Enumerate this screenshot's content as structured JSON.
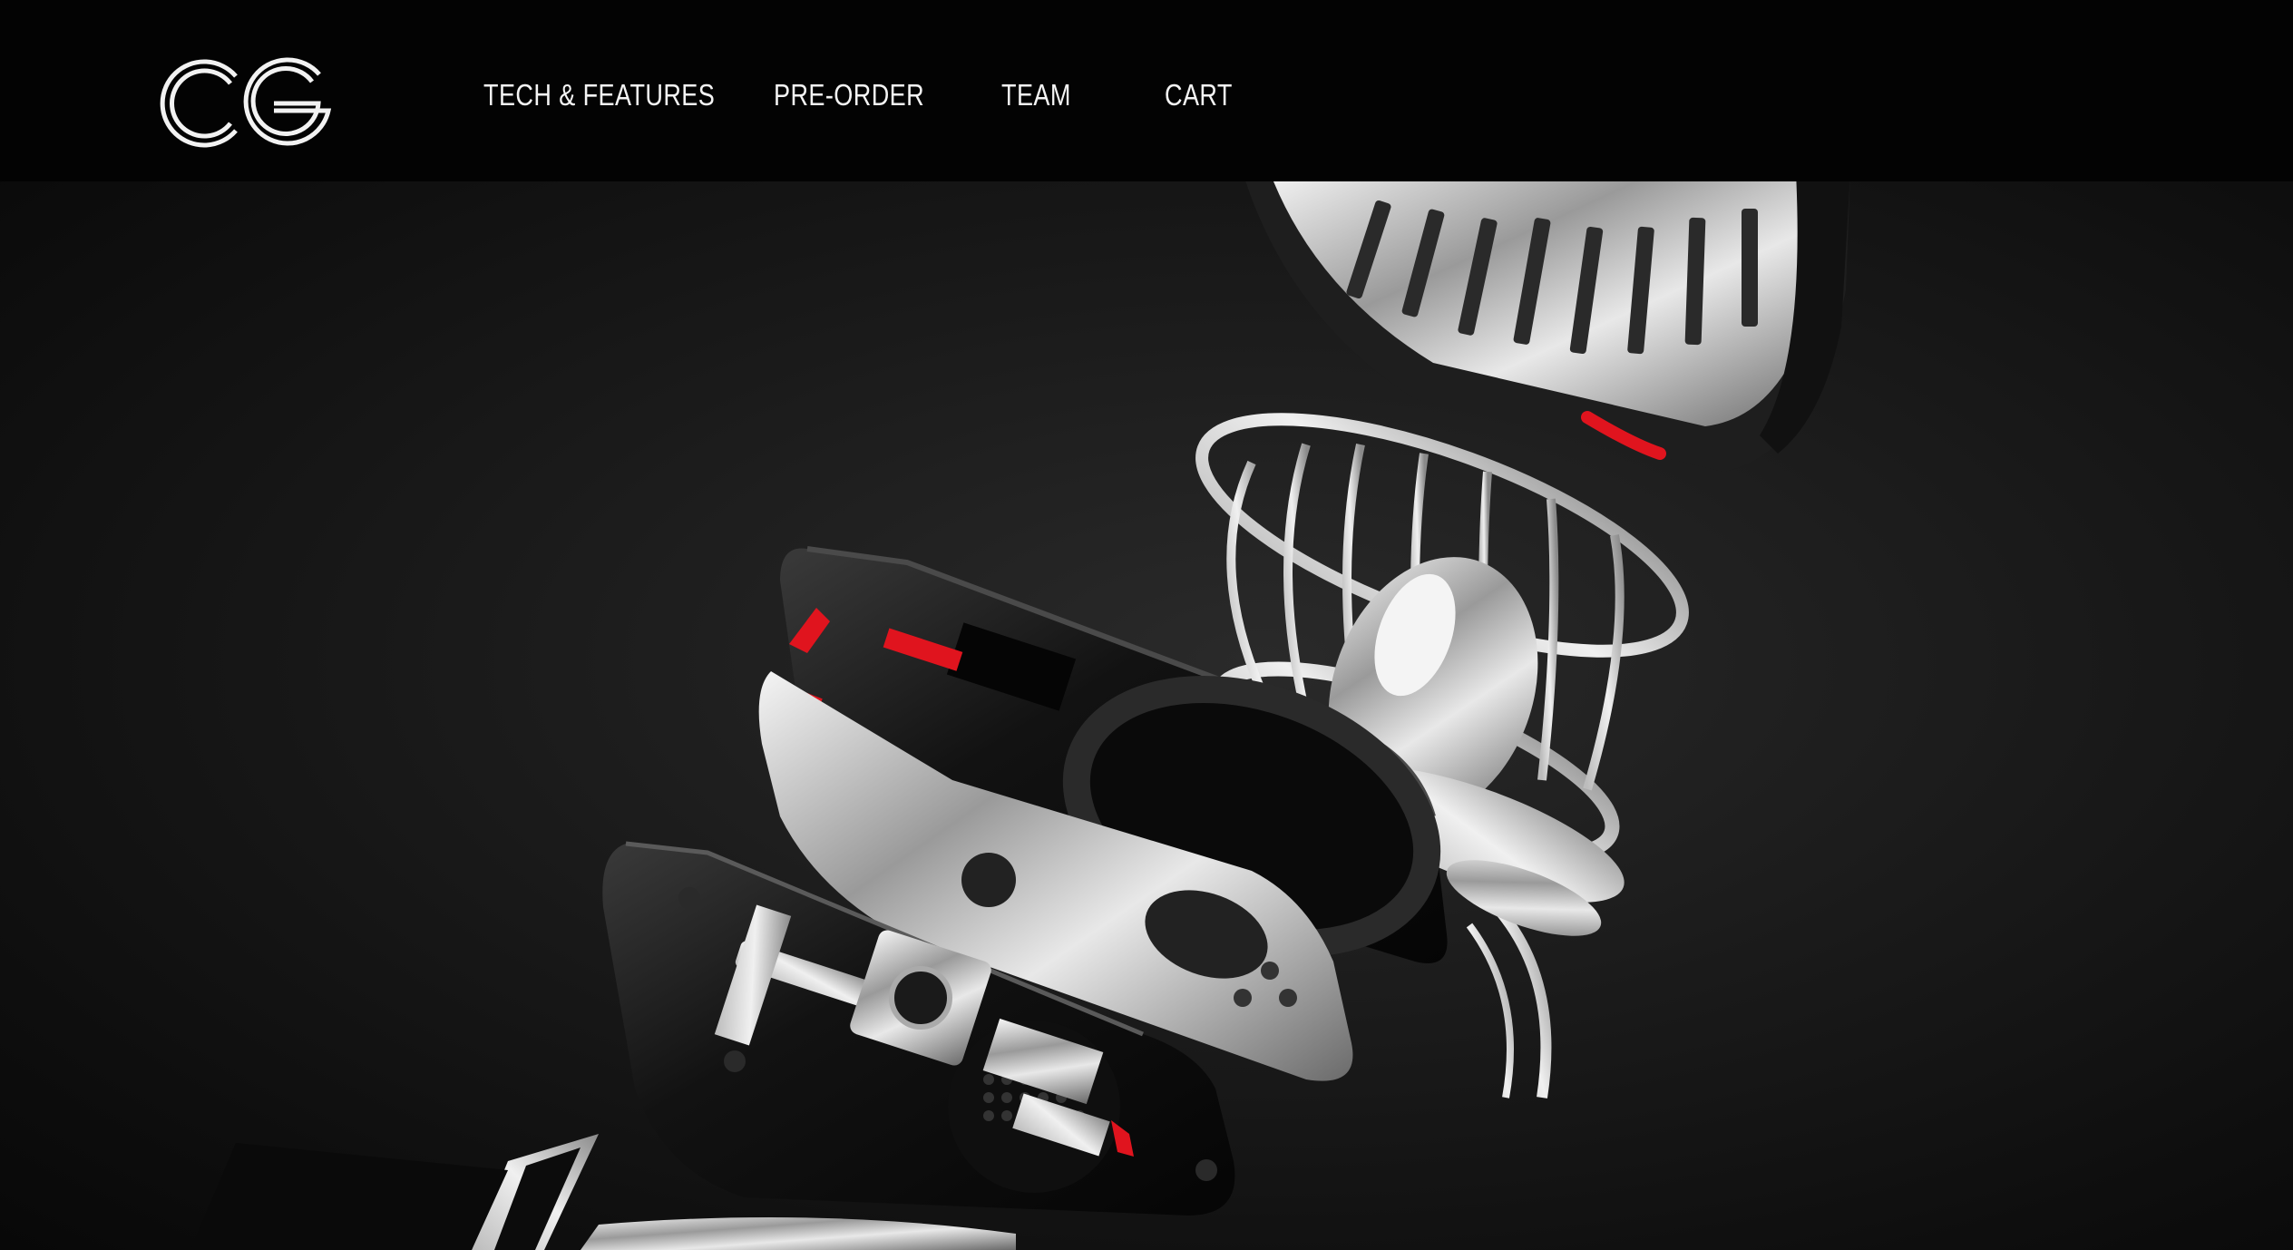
{
  "brand": {
    "logo_text": "CG"
  },
  "nav": {
    "items": [
      {
        "label": "TECH & FEATURES"
      },
      {
        "label": "PRE-ORDER"
      },
      {
        "label": "TEAM"
      },
      {
        "label": "CART"
      }
    ]
  },
  "hero": {
    "media": "exploded-product-render",
    "accent_color": "#e0141e",
    "background_color": "#1a1a1a",
    "metal_color": "#cfcfcf"
  }
}
